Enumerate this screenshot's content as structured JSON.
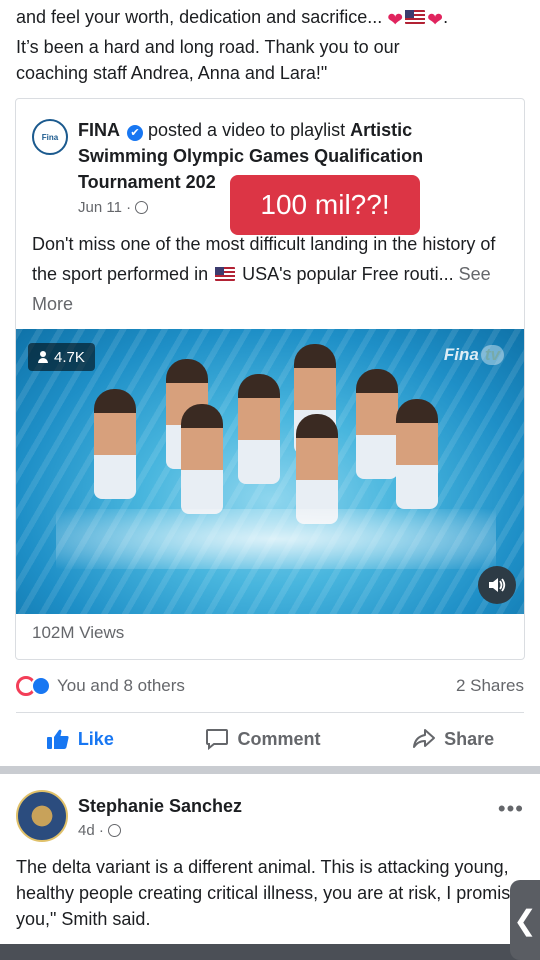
{
  "top_post": {
    "text_line1": "and feel your worth, dedication and sacrifice...",
    "text_line2": "It’s been a hard and long road. Thank you to our",
    "text_line3": "coaching staff Andrea, Anna and Lara!\""
  },
  "shared_post": {
    "avatar_text": "Fina",
    "page_name": "FINA",
    "verified_glyph": "✔",
    "action_text": " posted a video to playlist ",
    "playlist": "Artistic Swimming Olympic Games Qualification Tournament 202",
    "date": "Jun 11 ·",
    "description_part1": "Don't miss one of the most difficult landing in the history of the sport performed in ",
    "description_part2": " USA's popular Free routi... ",
    "see_more": "See More",
    "overlay": "100 mil??!",
    "video": {
      "viewer_count": "4.7K",
      "brand": "Fina",
      "brand_tv": "tv"
    },
    "views": "102M Views"
  },
  "engagement": {
    "reactions_text": "You and 8 others",
    "shares_text": "2 Shares"
  },
  "actions": {
    "like": "Like",
    "comment": "Comment",
    "share": "Share"
  },
  "second_post": {
    "author": "Stephanie Sanchez",
    "date": "4d ·",
    "more": "•••",
    "text": "The delta variant is a different animal. This is attacking young, healthy people creating critical illness, you are at risk, I promise you,\" Smith said.",
    "side_handle": "❮"
  },
  "colors": {
    "accent": "#1877f2",
    "overlay_red": "#dc3545",
    "muted": "#65676b"
  }
}
